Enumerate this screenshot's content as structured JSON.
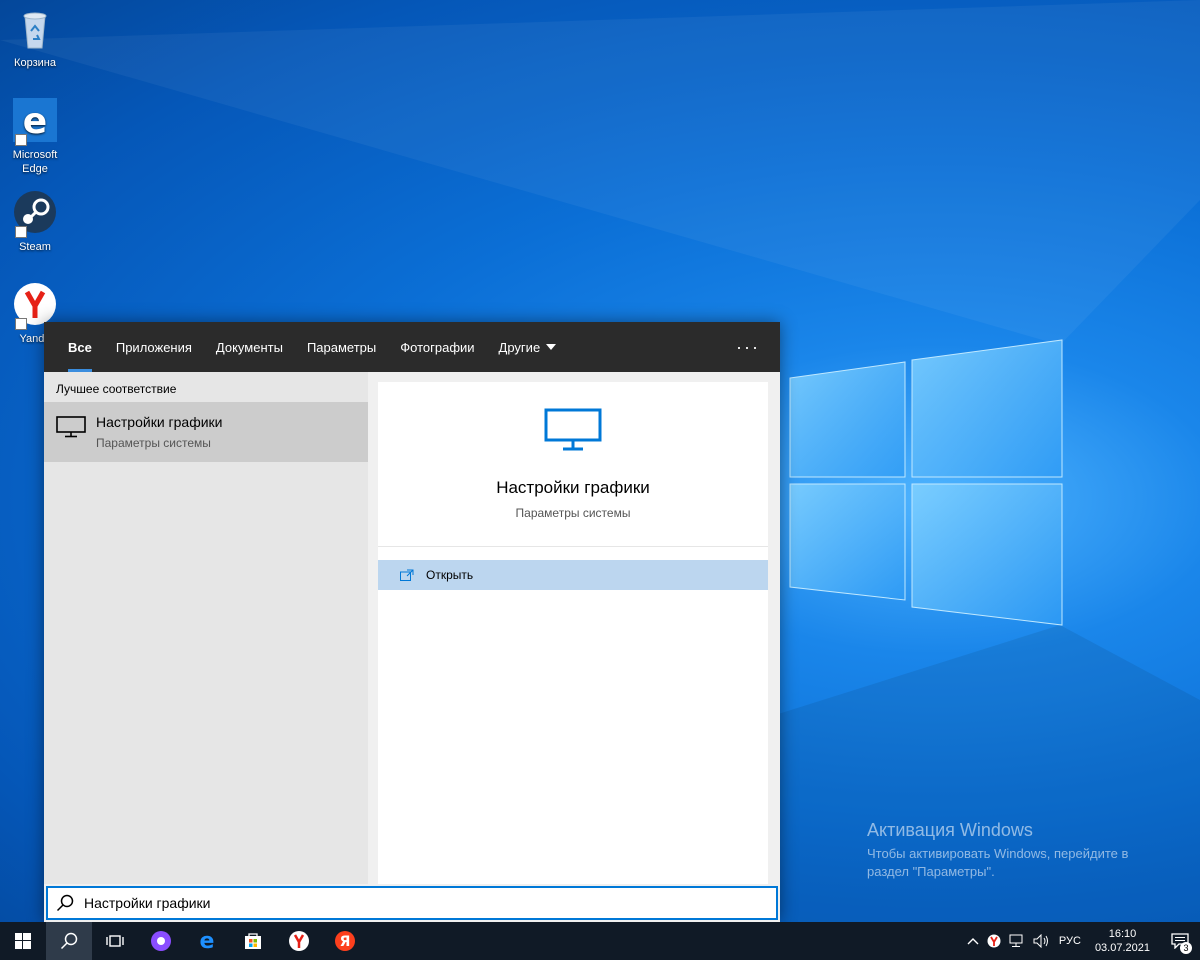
{
  "desktop": {
    "icons": [
      {
        "label": "Корзина",
        "icon": "recycle-bin-icon"
      },
      {
        "label": "Microsoft Edge",
        "icon": "edge-icon"
      },
      {
        "label": "Steam",
        "icon": "steam-icon"
      },
      {
        "label": "Yande",
        "icon": "yandex-browser-icon"
      }
    ]
  },
  "search": {
    "tabs": [
      {
        "label": "Все",
        "active": true
      },
      {
        "label": "Приложения"
      },
      {
        "label": "Документы"
      },
      {
        "label": "Параметры"
      },
      {
        "label": "Фотографии"
      },
      {
        "label": "Другие"
      }
    ],
    "more_label": "···",
    "best_match_label": "Лучшее соответствие",
    "result": {
      "title": "Настройки графики",
      "subtitle": "Параметры системы",
      "icon": "monitor-icon"
    },
    "preview": {
      "title": "Настройки графики",
      "subtitle": "Параметры системы"
    },
    "action_open": "Открыть",
    "query": "Настройки графики"
  },
  "activation": {
    "title": "Активация Windows",
    "text": "Чтобы активировать Windows, перейдите в раздел \"Параметры\"."
  },
  "taskbar": {
    "tray": {
      "language": "РУС",
      "time": "16:10",
      "date": "03.07.2021",
      "notifications": "3"
    }
  },
  "colors": {
    "accent": "#0078d7",
    "selection": "#bcd6ef",
    "tab_bar": "#2b2b2b",
    "taskbar": "#101a26"
  }
}
